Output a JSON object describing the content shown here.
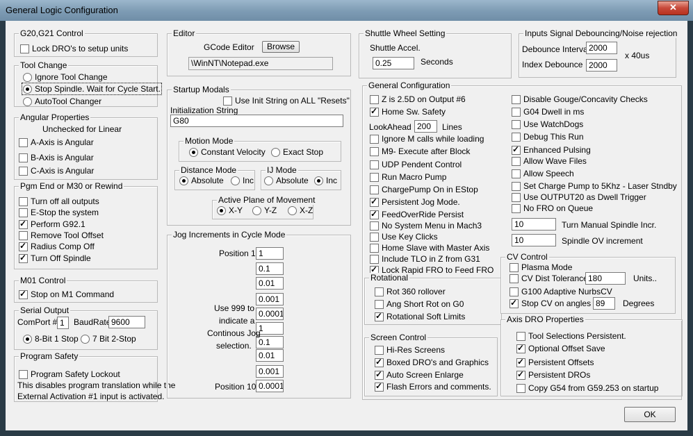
{
  "window": {
    "title": "General Logic Configuration",
    "close_glyph": "✕"
  },
  "g2021": {
    "label": "G20,G21 Control",
    "lock": "Lock DRO's to setup units"
  },
  "toolchange": {
    "label": "Tool Change",
    "ignore": "Ignore Tool Change",
    "stop": "Stop Spindle. Wait for Cycle Start.",
    "auto": "AutoTool Changer"
  },
  "angular": {
    "label": "Angular Properties",
    "note": "Unchecked for Linear",
    "a": "A-Axis is Angular",
    "b": "B-Axis is Angular",
    "c": "C-Axis is Angular"
  },
  "pgmend": {
    "label": "Pgm End or M30 or Rewind",
    "items": [
      "Turn off all outputs",
      "E-Stop the system",
      "Perform G92.1",
      "Remove Tool Offset",
      "Radius Comp Off",
      "Turn Off Spindle"
    ]
  },
  "m01": {
    "label": "M01 Control",
    "stop": "Stop on M1 Command"
  },
  "serial": {
    "label": "Serial Output",
    "comport_label": "ComPort #",
    "comport": "1",
    "baud_label": "BaudRate",
    "baud": "9600",
    "bit8": "8-Bit 1 Stop",
    "bit7": "7 Bit 2-Stop"
  },
  "safety": {
    "label": "Program Safety",
    "lockout": "Program Safety Lockout",
    "note1": "This disables program translation while the",
    "note2": "External Activation #1 input is activated."
  },
  "editor": {
    "label": "Editor",
    "gcode_label": "GCode Editor",
    "browse": "Browse",
    "path": "\\WinNT\\Notepad.exe"
  },
  "startup": {
    "label": "Startup Modals",
    "use_init": "Use Init String on ALL  \"Resets\"",
    "init_label": "Initialization String",
    "init_value": "G80",
    "motion": {
      "label": "Motion Mode",
      "cv": "Constant Velocity",
      "es": "Exact Stop"
    },
    "distance": {
      "label": "Distance Mode",
      "abs": "Absolute",
      "inc": "Inc"
    },
    "ij": {
      "label": "IJ Mode",
      "abs": "Absolute",
      "inc": "Inc"
    },
    "plane": {
      "label": "Active Plane of Movement",
      "xy": "X-Y",
      "yz": "Y-Z",
      "xz": "X-Z"
    }
  },
  "jog": {
    "label": "Jog Increments in Cycle Mode",
    "pos1": "Position 1",
    "pos10": "Position 10",
    "note": [
      "Use 999 to",
      "indicate a",
      "Continous Jog",
      "selection."
    ],
    "values": [
      "1",
      "0.1",
      "0.01",
      "0.001",
      "0.0001",
      "1",
      "0.1",
      "0.01",
      "0.001",
      "0.0001"
    ]
  },
  "shuttle": {
    "label": "Shuttle Wheel Setting",
    "accel_label": "Shuttle Accel.",
    "accel": "0.25",
    "seconds": "Seconds"
  },
  "debounce": {
    "label": "Inputs Signal Debouncing/Noise rejection",
    "interval_label": "Debounce Interval",
    "interval": "2000",
    "index_label": "Index Debounce",
    "index": "2000",
    "units": "x 40us"
  },
  "general": {
    "label": "General Configuration",
    "left": [
      "Z is 2.5D on Output #6",
      "Home Sw. Safety"
    ],
    "lookahead_label": "LookAhead",
    "lookahead": "200",
    "lines": "Lines",
    "left2": [
      "Ignore M calls while loading",
      "M9- Execute after Block",
      "UDP Pendent Control",
      "Run Macro Pump",
      "ChargePump On in EStop",
      "Persistent Jog Mode.",
      "FeedOverRide Persist",
      "No System Menu in Mach3",
      "Use Key Clicks",
      "Home Slave with Master Axis",
      "Include TLO in Z from G31",
      "Lock Rapid FRO to Feed FRO"
    ],
    "right": [
      "Disable Gouge/Concavity Checks",
      "G04 Dwell in ms",
      "Use WatchDogs",
      "Debug This Run",
      "Enhanced Pulsing",
      "Allow Wave Files",
      "Allow Speech",
      "Set Charge Pump to 5Khz  - Laser Stndby",
      "Use OUTPUT20 as Dwell Trigger",
      "No FRO on Queue"
    ],
    "turn_manual": "10",
    "turn_manual_label": "Turn Manual Spindle Incr.",
    "spindle_ov": "10",
    "spindle_ov_label": "Spindle OV increment"
  },
  "rotational": {
    "label": "Rotational",
    "items": [
      "Rot 360 rollover",
      "Ang Short Rot on G0",
      "Rotational Soft Limits"
    ]
  },
  "screen": {
    "label": "Screen Control",
    "items": [
      "Hi-Res Screens",
      "Boxed DRO's and Graphics",
      "Auto Screen Enlarge",
      "Flash Errors and comments."
    ]
  },
  "cv": {
    "label": "CV Control",
    "plasma": "Plasma Mode",
    "tol_label": "CV Dist Tolerance",
    "tol": "180",
    "units": "Units..",
    "g100": "G100 Adaptive NurbsCV",
    "stop_label": "Stop CV on angles >",
    "angle": "89",
    "degrees": "Degrees"
  },
  "axisdro": {
    "label": "Axis DRO Properties",
    "items": [
      "Tool Selections Persistent.",
      "Optional Offset Save",
      "Persistent Offsets",
      "Persistent DROs",
      "Copy G54 from G59.253 on startup"
    ]
  },
  "ok": "OK"
}
